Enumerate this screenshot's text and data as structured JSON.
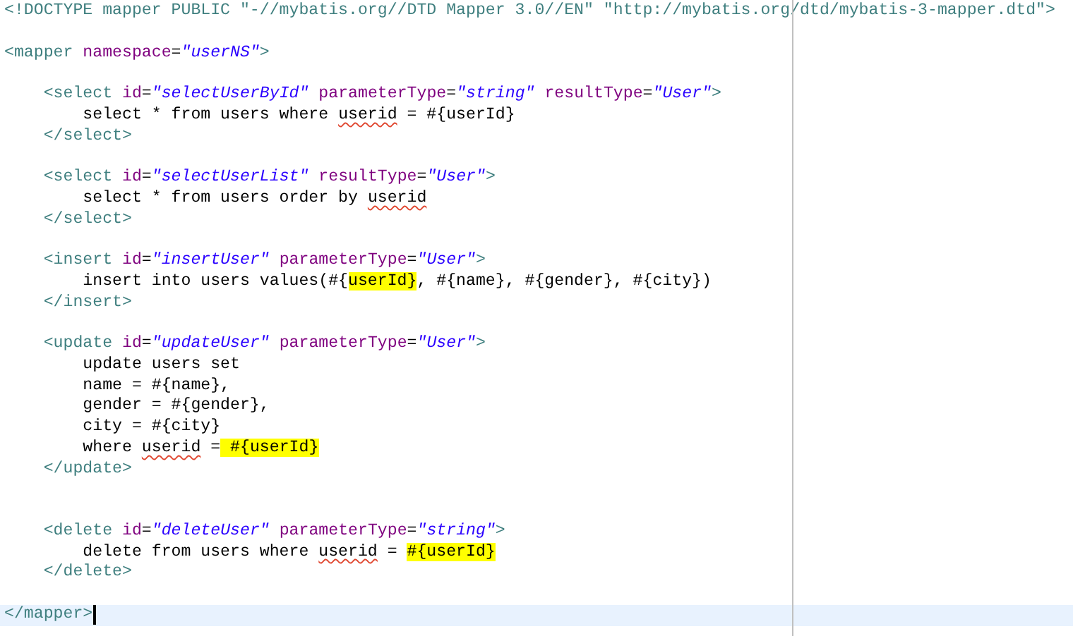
{
  "editor": {
    "lines": [
      {
        "current": false,
        "tokens": [
          {
            "kind": "tag",
            "text": "<!DOCTYPE mapper PUBLIC \"-//mybatis.org//DTD Mapper 3.0//EN\" \"http://mybatis.org/dtd/mybatis-3-mapper.dtd\">"
          }
        ]
      },
      {
        "current": false
      },
      {
        "current": false,
        "tokens": [
          {
            "kind": "tag",
            "text": "<mapper"
          },
          {
            "kind": "attr",
            "text": " namespace"
          },
          {
            "kind": "text",
            "text": "="
          },
          {
            "kind": "value",
            "text": "\"userNS\""
          },
          {
            "kind": "tag",
            "text": ">"
          }
        ]
      },
      {
        "current": false
      },
      {
        "current": false,
        "tokens": [
          {
            "kind": "tag",
            "text": "    <select"
          },
          {
            "kind": "attr",
            "text": " id"
          },
          {
            "kind": "text",
            "text": "="
          },
          {
            "kind": "value",
            "text": "\"selectUserById\""
          },
          {
            "kind": "attr",
            "text": " parameterType"
          },
          {
            "kind": "text",
            "text": "="
          },
          {
            "kind": "value",
            "text": "\"string\""
          },
          {
            "kind": "attr",
            "text": " resultType"
          },
          {
            "kind": "text",
            "text": "="
          },
          {
            "kind": "value",
            "text": "\"User\""
          },
          {
            "kind": "tag",
            "text": ">"
          }
        ]
      },
      {
        "current": false,
        "tokens": [
          {
            "kind": "text",
            "text": "        select * from users where "
          },
          {
            "kind": "misspelled",
            "text": "userid"
          },
          {
            "kind": "text",
            "text": " = #{userId}"
          }
        ]
      },
      {
        "current": false,
        "tokens": [
          {
            "kind": "tag",
            "text": "    </select>"
          }
        ]
      },
      {
        "current": false
      },
      {
        "current": false,
        "tokens": [
          {
            "kind": "tag",
            "text": "    <select"
          },
          {
            "kind": "attr",
            "text": " id"
          },
          {
            "kind": "text",
            "text": "="
          },
          {
            "kind": "value",
            "text": "\"selectUserList\""
          },
          {
            "kind": "attr",
            "text": " resultType"
          },
          {
            "kind": "text",
            "text": "="
          },
          {
            "kind": "value",
            "text": "\"User\""
          },
          {
            "kind": "tag",
            "text": ">"
          }
        ]
      },
      {
        "current": false,
        "tokens": [
          {
            "kind": "text",
            "text": "        select * from users order by "
          },
          {
            "kind": "misspelled",
            "text": "userid"
          }
        ]
      },
      {
        "current": false,
        "tokens": [
          {
            "kind": "tag",
            "text": "    </select>"
          }
        ]
      },
      {
        "current": false
      },
      {
        "current": false,
        "tokens": [
          {
            "kind": "tag",
            "text": "    <insert"
          },
          {
            "kind": "attr",
            "text": " id"
          },
          {
            "kind": "text",
            "text": "="
          },
          {
            "kind": "value",
            "text": "\"insertUser\""
          },
          {
            "kind": "attr",
            "text": " parameterType"
          },
          {
            "kind": "text",
            "text": "="
          },
          {
            "kind": "value",
            "text": "\"User\""
          },
          {
            "kind": "tag",
            "text": ">"
          }
        ]
      },
      {
        "current": false,
        "tokens": [
          {
            "kind": "text",
            "text": "        insert into users values(#{"
          },
          {
            "kind": "highlight",
            "text": "userId}"
          },
          {
            "kind": "text",
            "text": ", #{name}, #{gender}, #{city})"
          }
        ]
      },
      {
        "current": false,
        "tokens": [
          {
            "kind": "tag",
            "text": "    </insert>"
          }
        ]
      },
      {
        "current": false
      },
      {
        "current": false,
        "tokens": [
          {
            "kind": "tag",
            "text": "    <update"
          },
          {
            "kind": "attr",
            "text": " id"
          },
          {
            "kind": "text",
            "text": "="
          },
          {
            "kind": "value",
            "text": "\"updateUser\""
          },
          {
            "kind": "attr",
            "text": " parameterType"
          },
          {
            "kind": "text",
            "text": "="
          },
          {
            "kind": "value",
            "text": "\"User\""
          },
          {
            "kind": "tag",
            "text": ">"
          }
        ]
      },
      {
        "current": false,
        "tokens": [
          {
            "kind": "text",
            "text": "        update users set"
          }
        ]
      },
      {
        "current": false,
        "tokens": [
          {
            "kind": "text",
            "text": "        name = #{name},"
          }
        ]
      },
      {
        "current": false,
        "tokens": [
          {
            "kind": "text",
            "text": "        gender = #{gender},"
          }
        ]
      },
      {
        "current": false,
        "tokens": [
          {
            "kind": "text",
            "text": "        city = #{city}"
          }
        ]
      },
      {
        "current": false,
        "tokens": [
          {
            "kind": "text",
            "text": "        where "
          },
          {
            "kind": "misspelled",
            "text": "userid"
          },
          {
            "kind": "text",
            "text": " ="
          },
          {
            "kind": "highlight",
            "text": " #{userId}"
          }
        ]
      },
      {
        "current": false,
        "tokens": [
          {
            "kind": "tag",
            "text": "    </update>"
          }
        ]
      },
      {
        "current": false
      },
      {
        "current": false
      },
      {
        "current": false,
        "tokens": [
          {
            "kind": "tag",
            "text": "    <delete"
          },
          {
            "kind": "attr",
            "text": " id"
          },
          {
            "kind": "text",
            "text": "="
          },
          {
            "kind": "value",
            "text": "\"deleteUser\""
          },
          {
            "kind": "attr",
            "text": " parameterType"
          },
          {
            "kind": "text",
            "text": "="
          },
          {
            "kind": "value",
            "text": "\"string\""
          },
          {
            "kind": "tag",
            "text": ">"
          }
        ]
      },
      {
        "current": false,
        "tokens": [
          {
            "kind": "text",
            "text": "        delete from users where "
          },
          {
            "kind": "misspelled",
            "text": "userid"
          },
          {
            "kind": "text",
            "text": " = "
          },
          {
            "kind": "highlight",
            "text": "#{userId}"
          }
        ]
      },
      {
        "current": false,
        "tokens": [
          {
            "kind": "tag",
            "text": "    </delete>"
          }
        ]
      },
      {
        "current": false
      },
      {
        "current": true,
        "tokens": [
          {
            "kind": "tag",
            "text": "</mapper>"
          }
        ]
      }
    ]
  }
}
